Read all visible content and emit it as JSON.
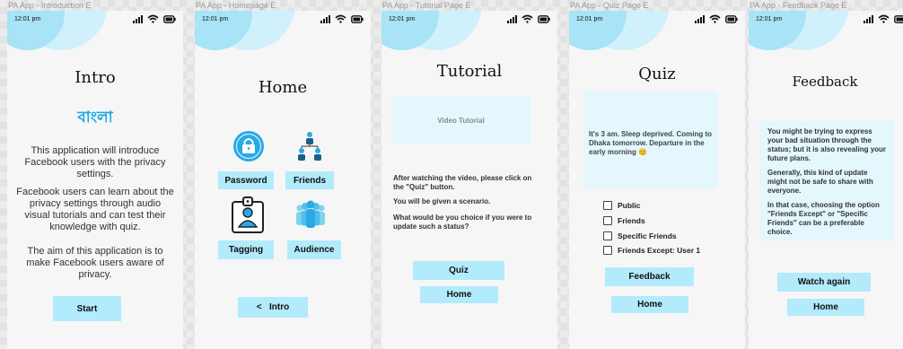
{
  "statusbar": {
    "time": "12:01 pm"
  },
  "frames": {
    "intro": {
      "frame_label": "PA App - Introduction E",
      "title": "Intro",
      "bangla": "বাংলা",
      "p1": "This application will introduce Facebook users with the privacy settings.",
      "p2": "Facebook users can learn about the privacy settings through audio visual tutorials and can test their knowledge with quiz.",
      "p3": "The aim of this application is to make Facebook users aware of privacy.",
      "start_label": "Start"
    },
    "home": {
      "frame_label": "PA App - Homepage E",
      "title": "Home",
      "password_label": "Password",
      "friends_label": "Friends",
      "tagging_label": "Tagging",
      "audience_label": "Audience",
      "intro_label": "<   Intro"
    },
    "tutorial": {
      "frame_label": "PA App - Tutorial Page E",
      "title": "Tutorial",
      "video_label": "Video Tutorial",
      "p1": "After watching the video, please click on the \"Quiz\" button.",
      "p2": "You will be given a scenario.",
      "p3": "What would be you choice if you were to update such a status?",
      "quiz_label": "Quiz",
      "home_label": "Home"
    },
    "quiz": {
      "frame_label": "PA App - Quiz Page E",
      "title": "Quiz",
      "scenario": "It's 3 am. Sleep deprived. Coming to Dhaka tomorrow. Departure in the early morning 😊",
      "options": [
        "Public",
        "Friends",
        "Specific Friends",
        "Friends Except: User 1"
      ],
      "feedback_label": "Feedback",
      "home_label": "Home"
    },
    "feedback": {
      "frame_label": "PA App - Feedback Page E",
      "title": "Feedback",
      "p1": "You might be trying to express your bad situation through the status; but it is also revealing your future plans.",
      "p2": "Generally, this kind of update might not be safe to share with everyone.",
      "p3": "In that case, choosing the option \"Friends Except\" or \"Specific Friends\" can be a preferable choice.",
      "watch_label": "Watch again",
      "home_label": "Home"
    }
  },
  "colors": {
    "accent": "#b2ebfb",
    "bangla": "#1ba8e0",
    "icon_blue": "#29a9e6"
  },
  "icons": [
    "signal-icon",
    "wifi-icon",
    "battery-icon",
    "lock-icon",
    "people-hierarchy-icon",
    "id-badge-icon",
    "group-icon"
  ]
}
